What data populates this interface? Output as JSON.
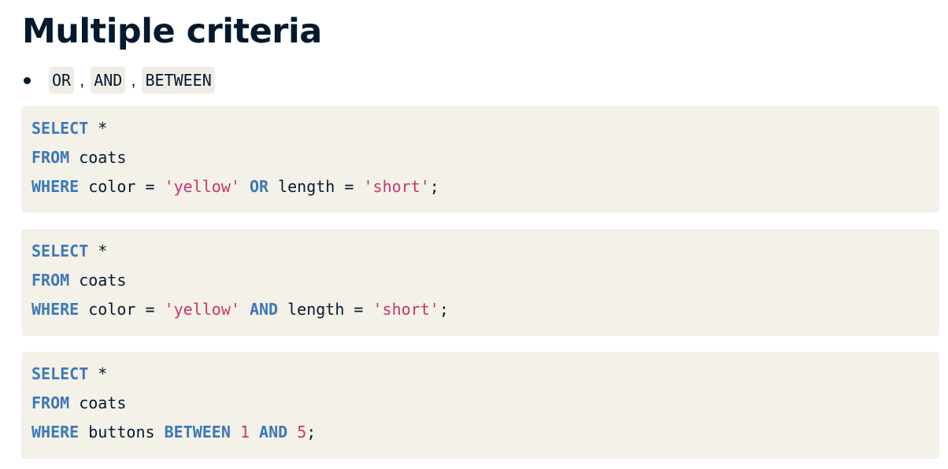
{
  "page": {
    "title": "Multiple criteria",
    "bullet": {
      "chips": [
        "OR",
        "AND",
        "BETWEEN"
      ],
      "separator": ","
    }
  },
  "code_blocks": [
    {
      "lines": [
        [
          {
            "t": "SELECT",
            "k": "kw"
          },
          {
            "t": " *",
            "k": "plain"
          }
        ],
        [
          {
            "t": "FROM",
            "k": "kw"
          },
          {
            "t": " coats",
            "k": "plain"
          }
        ],
        [
          {
            "t": "WHERE",
            "k": "kw"
          },
          {
            "t": " color = ",
            "k": "plain"
          },
          {
            "t": "'yellow'",
            "k": "str"
          },
          {
            "t": " ",
            "k": "plain"
          },
          {
            "t": "OR",
            "k": "kw"
          },
          {
            "t": " length = ",
            "k": "plain"
          },
          {
            "t": "'short'",
            "k": "str"
          },
          {
            "t": ";",
            "k": "plain"
          }
        ]
      ]
    },
    {
      "lines": [
        [
          {
            "t": "SELECT",
            "k": "kw"
          },
          {
            "t": " *",
            "k": "plain"
          }
        ],
        [
          {
            "t": "FROM",
            "k": "kw"
          },
          {
            "t": " coats",
            "k": "plain"
          }
        ],
        [
          {
            "t": "WHERE",
            "k": "kw"
          },
          {
            "t": " color = ",
            "k": "plain"
          },
          {
            "t": "'yellow'",
            "k": "str"
          },
          {
            "t": " ",
            "k": "plain"
          },
          {
            "t": "AND",
            "k": "kw"
          },
          {
            "t": " length = ",
            "k": "plain"
          },
          {
            "t": "'short'",
            "k": "str"
          },
          {
            "t": ";",
            "k": "plain"
          }
        ]
      ]
    },
    {
      "lines": [
        [
          {
            "t": "SELECT",
            "k": "kw"
          },
          {
            "t": " *",
            "k": "plain"
          }
        ],
        [
          {
            "t": "FROM",
            "k": "kw"
          },
          {
            "t": " coats",
            "k": "plain"
          }
        ],
        [
          {
            "t": "WHERE",
            "k": "kw"
          },
          {
            "t": " buttons ",
            "k": "plain"
          },
          {
            "t": "BETWEEN",
            "k": "kw"
          },
          {
            "t": " ",
            "k": "plain"
          },
          {
            "t": "1",
            "k": "num"
          },
          {
            "t": " ",
            "k": "plain"
          },
          {
            "t": "AND",
            "k": "kw"
          },
          {
            "t": " ",
            "k": "plain"
          },
          {
            "t": "5",
            "k": "num"
          },
          {
            "t": ";",
            "k": "plain"
          }
        ]
      ]
    }
  ],
  "colors": {
    "keyword": "#3b79b6",
    "string": "#c4386b",
    "text": "#05192d",
    "code_background": "#f4f1e9",
    "chip_background": "#efede6"
  }
}
